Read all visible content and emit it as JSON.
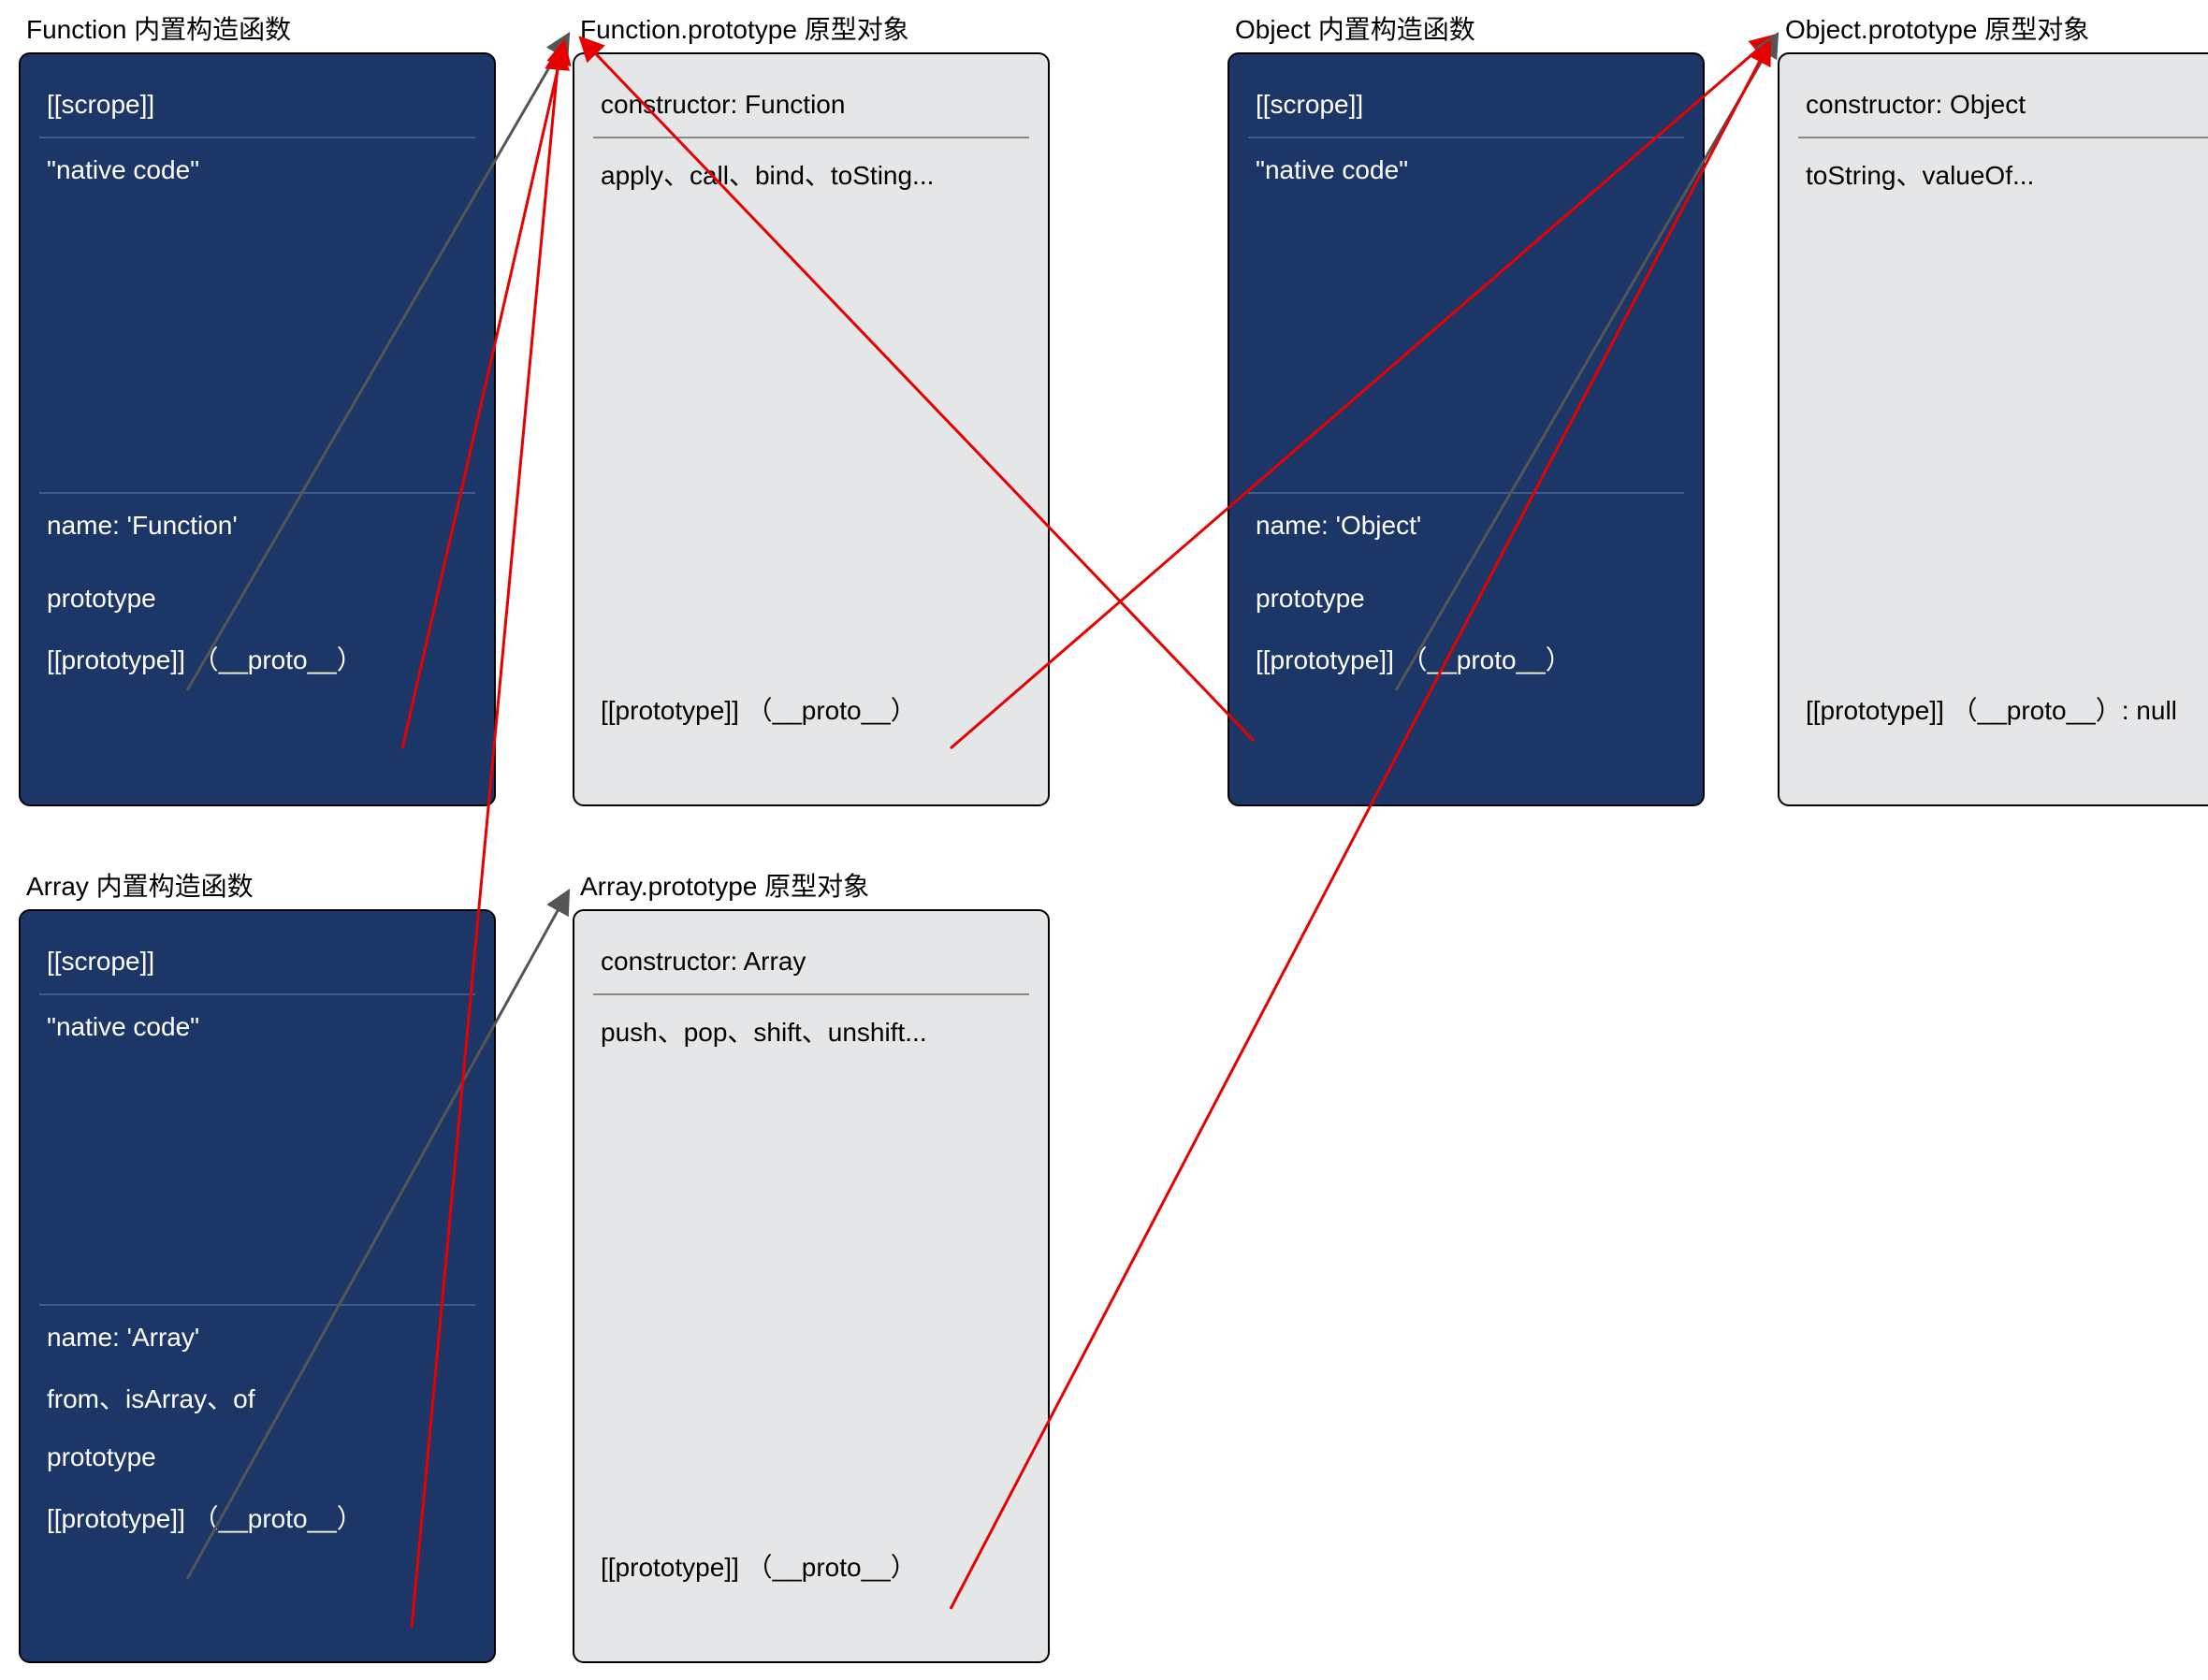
{
  "titles": {
    "function_ctor": "Function 内置构造函数",
    "function_proto": "Function.prototype 原型对象",
    "object_ctor": "Object 内置构造函数",
    "object_proto": "Object.prototype 原型对象",
    "array_ctor": "Array 内置构造函数",
    "array_proto": "Array.prototype 原型对象"
  },
  "function_ctor": {
    "scope": "[[scrope]]",
    "body": "\"native code\"",
    "name": "name: 'Function'",
    "prototype": "prototype",
    "proto": "[[prototype]] （__proto__）"
  },
  "function_proto": {
    "constructor": "constructor: Function",
    "methods": "apply、call、bind、toSting...",
    "proto": "[[prototype]] （__proto__）"
  },
  "object_ctor": {
    "scope": "[[scrope]]",
    "body": "\"native code\"",
    "name": "name: 'Object'",
    "prototype": "prototype",
    "proto": "[[prototype]] （__proto__）"
  },
  "object_proto": {
    "constructor": "constructor: Object",
    "methods": "toString、valueOf...",
    "proto": "[[prototype]] （__proto__）: null"
  },
  "array_ctor": {
    "scope": "[[scrope]]",
    "body": "\"native code\"",
    "name": "name: 'Array'",
    "statics": "from、isArray、of",
    "prototype": "prototype",
    "proto": "[[prototype]] （__proto__）"
  },
  "array_proto": {
    "constructor": "constructor: Array",
    "methods": "push、pop、shift、unshift...",
    "proto": "[[prototype]] （__proto__）"
  },
  "arrows": [
    {
      "from": "function_ctor.prototype",
      "to": "function_proto",
      "color": "gray"
    },
    {
      "from": "function_ctor.proto",
      "to": "function_proto",
      "color": "red"
    },
    {
      "from": "function_proto.proto",
      "to": "object_proto",
      "color": "red"
    },
    {
      "from": "object_ctor.prototype",
      "to": "object_proto",
      "color": "gray"
    },
    {
      "from": "object_ctor.proto",
      "to": "function_proto",
      "color": "red"
    },
    {
      "from": "array_ctor.prototype",
      "to": "array_proto",
      "color": "gray"
    },
    {
      "from": "array_ctor.proto",
      "to": "function_proto",
      "color": "red"
    },
    {
      "from": "array_proto.proto",
      "to": "object_proto",
      "color": "red"
    }
  ]
}
